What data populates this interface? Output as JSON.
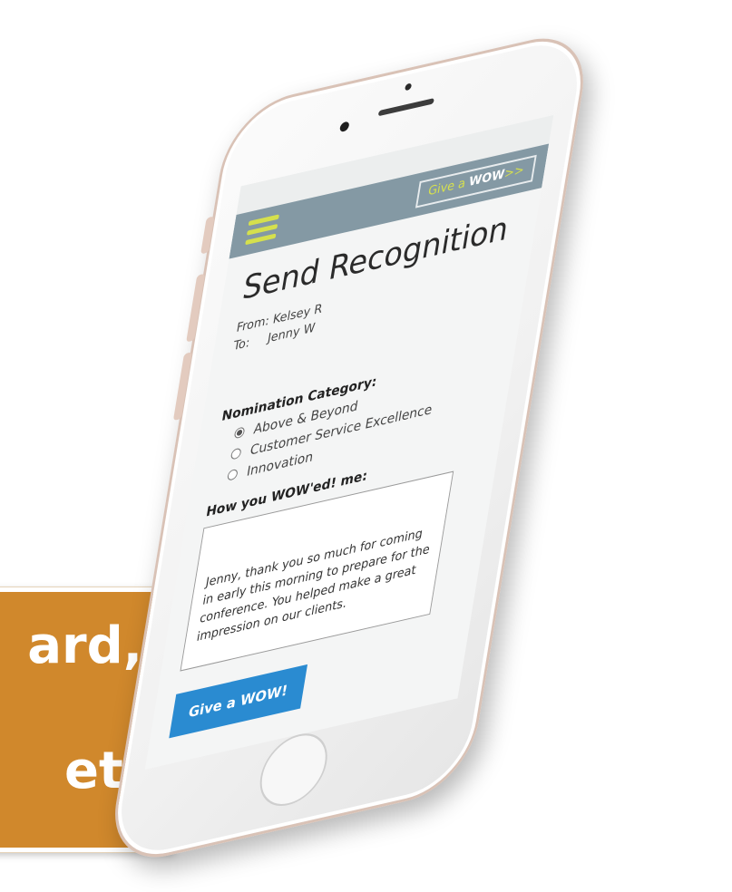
{
  "callout": {
    "line1": "ard,",
    "line2": "et.",
    "background": "#d0882c"
  },
  "app": {
    "header": {
      "menu_icon": "hamburger-menu-icon",
      "give_prefix": "Give a",
      "give_wow": "WOW",
      "give_suffix": ">>"
    },
    "title": "Send Recognition",
    "from_label": "From:",
    "from_value": "Kelsey R",
    "to_label": "To:",
    "to_value": "Jenny W",
    "nomination_label": "Nomination Category:",
    "categories": [
      {
        "label": "Above & Beyond",
        "selected": true
      },
      {
        "label": "Customer Service Excellence",
        "selected": false
      },
      {
        "label": "Innovation",
        "selected": false
      }
    ],
    "message_label": "How you WOW'ed! me:",
    "message": "Jenny, thank you so much for coming in early this morning to prepare for the conference. You helped make a great impression on our clients.",
    "submit_label": "Give a WOW!"
  },
  "colors": {
    "appbar": "#8499a4",
    "accent": "#d5e04d",
    "submit": "#2a8bd1"
  }
}
